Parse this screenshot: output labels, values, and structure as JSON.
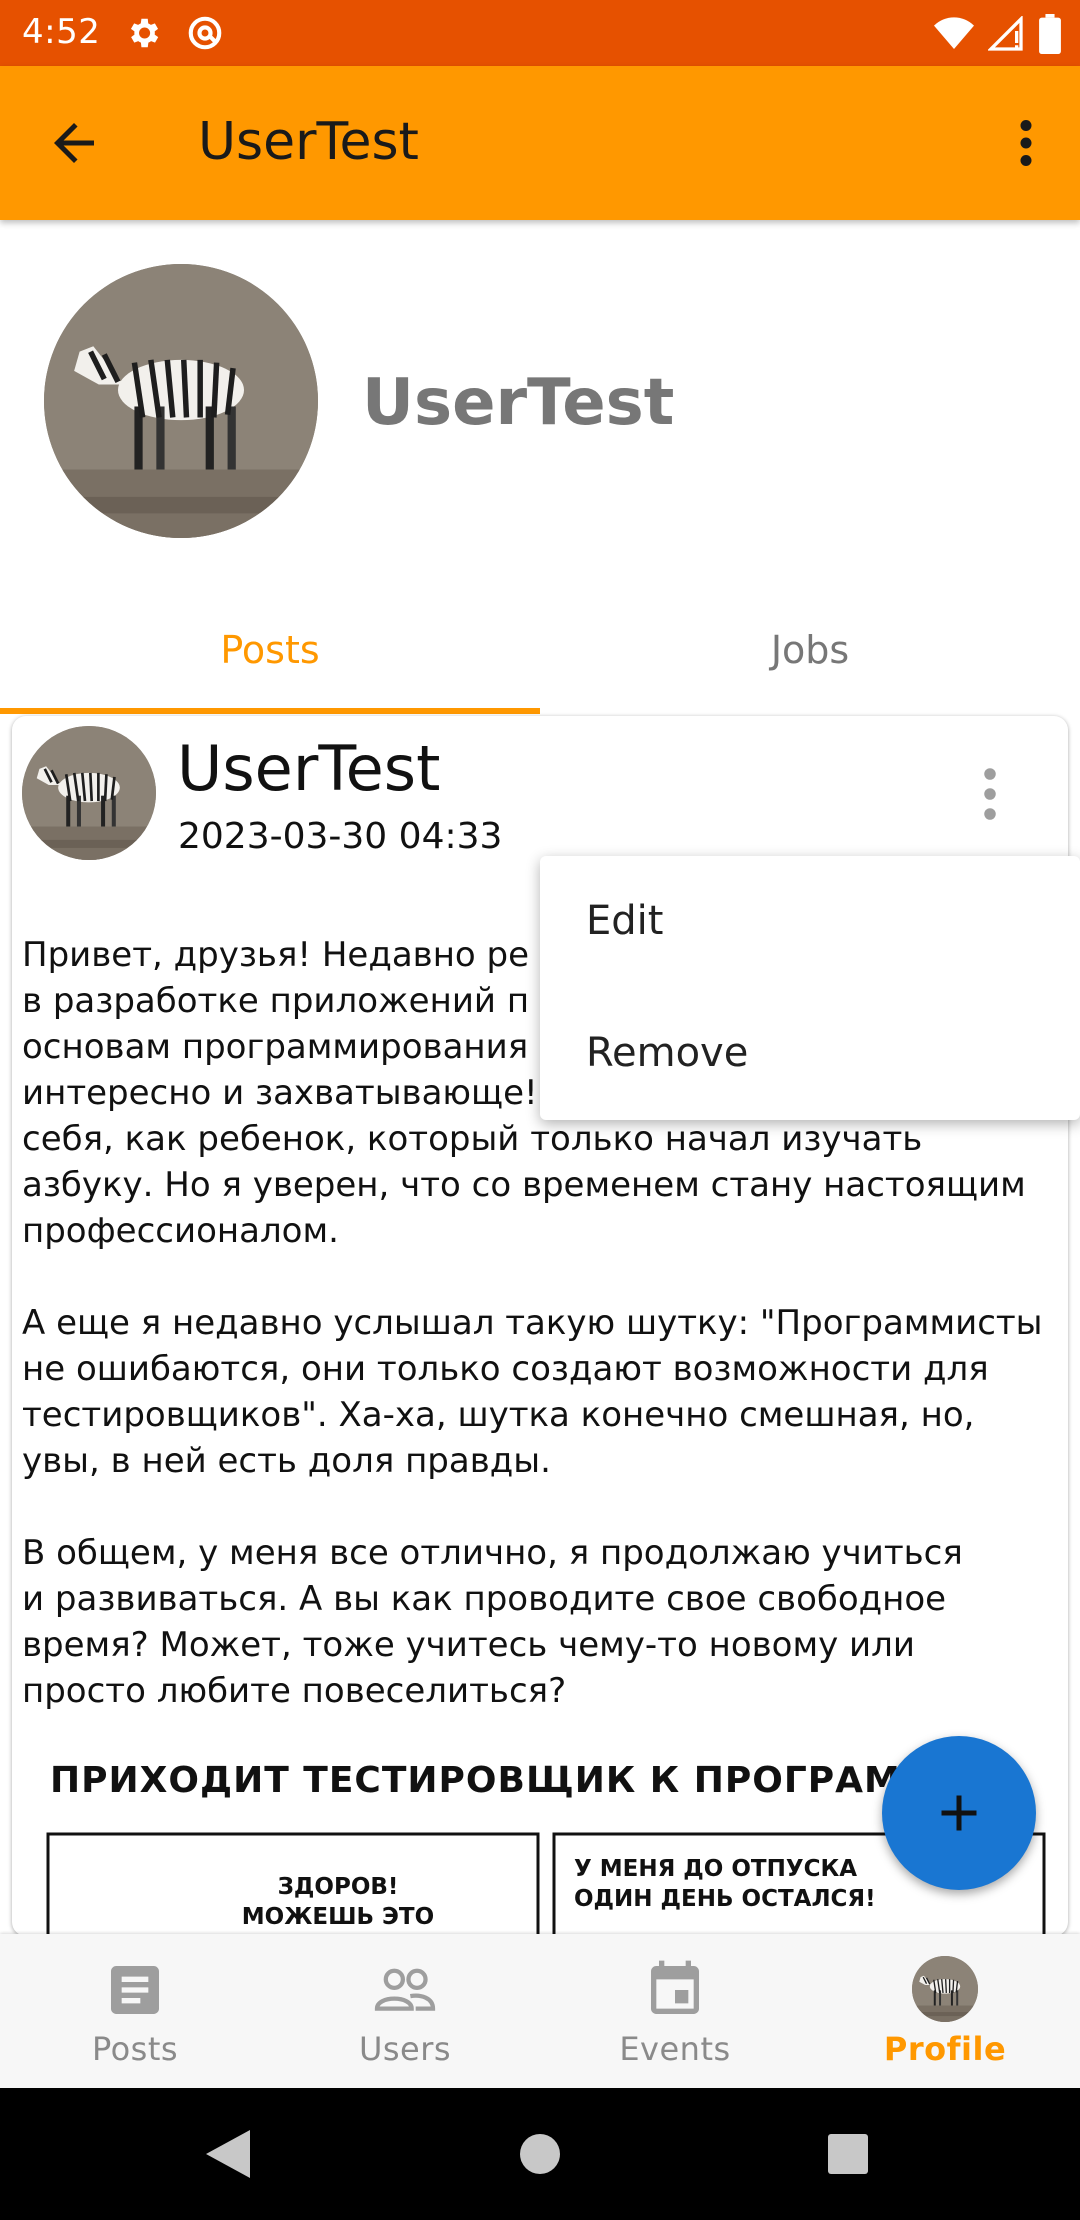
{
  "status_bar": {
    "time": "4:52",
    "left_icons": [
      "settings-icon",
      "at-sign-icon"
    ],
    "right_icons": [
      "wifi-icon",
      "signal-icon",
      "battery-icon"
    ],
    "color": "#e65100"
  },
  "app_bar": {
    "title": "UserTest",
    "back_icon": "arrow-back-icon",
    "menu_icon": "more-vert-icon",
    "color": "#ff9800"
  },
  "profile": {
    "name": "UserTest",
    "avatar": "zebra-avatar"
  },
  "tabs": [
    {
      "label": "Posts",
      "active": true
    },
    {
      "label": "Jobs",
      "active": false
    }
  ],
  "post": {
    "author": "UserTest",
    "date": "2023-03-30 04:33",
    "content": "Привет, друзья! Недавно ре\nв разработке приложений п\nосновам программирования\nинтересно и захватывающе!\nсебя, как ребенок, который только начал изучать\nазбуку. Но я уверен, что со временем стану настоящим\nпрофессионалом.\n\nА еще я недавно услышал такую шутку: \"Программисты\nне ошибаются, они только создают возможности для\nтестировщиков\". Ха-ха, шутка конечно смешная, но,\nувы, в ней есть доля правды.\n\nВ общем, у меня все отлично, я продолжаю учиться\nи развиваться. А вы как проводите свое свободное\nвремя? Может, тоже учитесь чему-то новому или\nпросто любите повеселиться?",
    "comic": {
      "title": "ПРИХОДИТ ТЕСТИРОВЩИК К ПРОГРАММИ",
      "panel1_line1": "ЗДОРОВ!",
      "panel1_line2": "МОЖЕШЬ ЭТО",
      "panel2_line1": "У МЕНЯ ДО ОТПУСКА",
      "panel2_line2": "ОДИН ДЕНЬ ОСТАЛСЯ!"
    }
  },
  "popup_menu": {
    "items": [
      {
        "label": "Edit"
      },
      {
        "label": "Remove"
      }
    ]
  },
  "fab": {
    "icon": "plus-icon",
    "color": "#1976d2"
  },
  "bottom_nav": {
    "items": [
      {
        "label": "Posts",
        "icon": "article-icon",
        "active": false
      },
      {
        "label": "Users",
        "icon": "people-icon",
        "active": false
      },
      {
        "label": "Events",
        "icon": "event-icon",
        "active": false
      },
      {
        "label": "Profile",
        "icon": "profile-avatar-icon",
        "active": true
      }
    ],
    "active_color": "#ff9800"
  },
  "system_nav": [
    "back-triangle-icon",
    "home-circle-icon",
    "recents-square-icon"
  ]
}
